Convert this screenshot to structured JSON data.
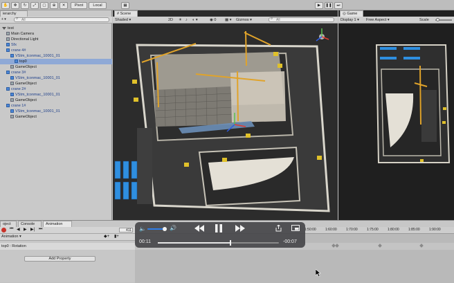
{
  "toolbar": {
    "pivot_label": "Pivot",
    "local_label": "Local"
  },
  "hierarchy": {
    "tab_label": "ierarchy",
    "search_placeholder": "All",
    "rows": [
      {
        "label": "test",
        "type": "scene"
      },
      {
        "label": "Main Camera",
        "type": "object"
      },
      {
        "label": "Directional Light",
        "type": "object"
      },
      {
        "label": "Sfx",
        "type": "prefab"
      },
      {
        "label": "crane 4#",
        "type": "prefab"
      },
      {
        "label": "VStm_tconmac_10001_01",
        "type": "prefab"
      },
      {
        "label": "top0",
        "type": "selected"
      },
      {
        "label": "GameObject",
        "type": "object"
      },
      {
        "label": "crane 3#",
        "type": "prefab"
      },
      {
        "label": "VStm_tconmac_10001_01",
        "type": "prefab"
      },
      {
        "label": "GameObject",
        "type": "object"
      },
      {
        "label": "crane 2#",
        "type": "prefab"
      },
      {
        "label": "VStm_tconmac_10001_01",
        "type": "prefab"
      },
      {
        "label": "GameObject",
        "type": "object"
      },
      {
        "label": "crane 1#",
        "type": "prefab"
      },
      {
        "label": "VStm_tconmac_10001_01",
        "type": "prefab"
      },
      {
        "label": "GameObject",
        "type": "object"
      }
    ]
  },
  "scene": {
    "tab_label": "Scene",
    "shading_mode": "Shaded",
    "mode_2d": "2D",
    "gizmos_label": "Gizmos",
    "search_placeholder": "All",
    "labels": {
      "none": ""
    }
  },
  "game": {
    "tab_label": "Game",
    "display": "Display 1",
    "aspect": "Free Aspect",
    "scale_label": "Scale"
  },
  "bottom": {
    "tabs": [
      "oject",
      "Console",
      "Animation"
    ],
    "animation_label": "Animation",
    "frame_value": "411",
    "property_row": "top0 : Rotation",
    "add_property_label": "Add Property",
    "timeline_ticks": [
      "1:50:00",
      "1:60:00",
      "1:70:00",
      "1:75:00",
      "1:80:00",
      "1:85:00",
      "1:90:00"
    ]
  },
  "player": {
    "elapsed": "00:11",
    "remaining": "-00:07",
    "volume_level": 0.9,
    "progress": 0.6
  }
}
